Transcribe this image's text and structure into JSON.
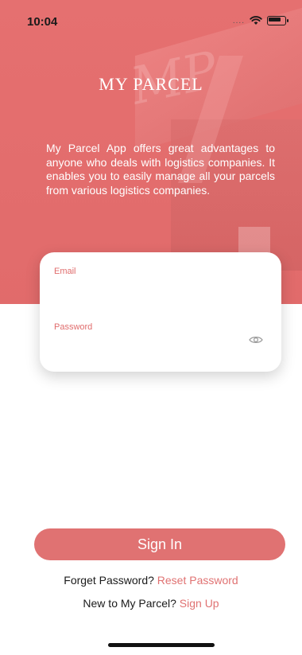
{
  "status_bar": {
    "time": "10:04",
    "signal": "...."
  },
  "app": {
    "title": "MY PARCEL"
  },
  "intro": {
    "text": "My Parcel App offers great advantages to anyone who deals with logistics companies. It enables you to easily manage all your parcels from various logistics companies."
  },
  "form": {
    "email_label": "Email",
    "password_label": "Password"
  },
  "actions": {
    "sign_in_label": "Sign In",
    "forget_password_text": "Forget Password?",
    "reset_password_link": "Reset Password",
    "new_user_text": "New to My Parcel?",
    "sign_up_link": "Sign Up"
  },
  "colors": {
    "accent": "#e07272",
    "hero": "#e36d6d"
  },
  "icons": {
    "password_visibility": "eye-icon",
    "wifi": "wifi-icon",
    "battery": "battery-icon"
  }
}
